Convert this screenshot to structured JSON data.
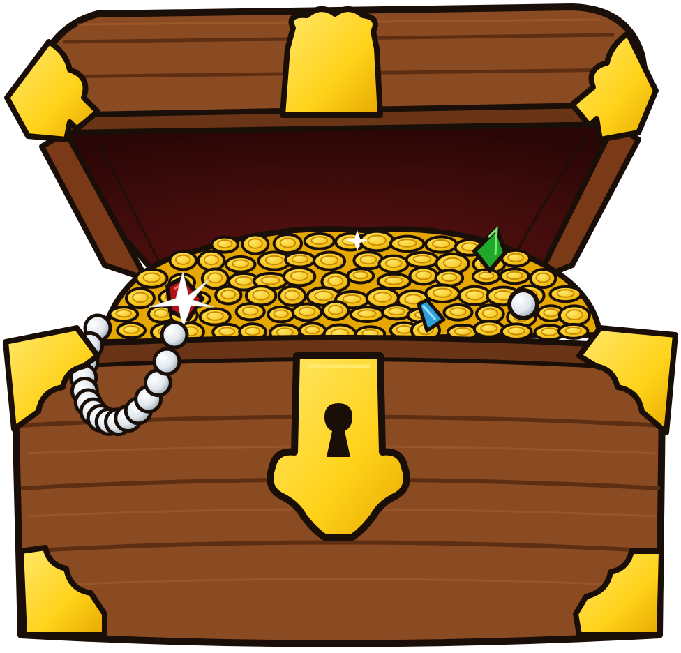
{
  "scene": {
    "subject": "treasure-chest",
    "colors": {
      "outline": "#1a0f08",
      "wood": "#8a4a22",
      "wood_dark": "#5e2e12",
      "wood_light": "#a8622e",
      "interior": "#3a0a0a",
      "interior_mid": "#5a1212",
      "gold": "#ffd21a",
      "gold_shade": "#e6a800",
      "gold_light": "#ffe86a",
      "coin": "#f5c21b",
      "coin_edge": "#c98a00",
      "pearl": "#dfe6ec",
      "pearl_shade": "#9aa6b0",
      "ruby": "#b0121a",
      "emerald": "#1fa82a",
      "sapphire": "#2a9fd8",
      "keyhole": "#1a0f08"
    },
    "elements": [
      "lid",
      "interior",
      "gold-coins",
      "pearl-necklace",
      "ruby",
      "emerald",
      "sapphire",
      "pearl",
      "chest-body",
      "lock-plate",
      "keyhole",
      "corner-brackets",
      "sparkles"
    ]
  }
}
